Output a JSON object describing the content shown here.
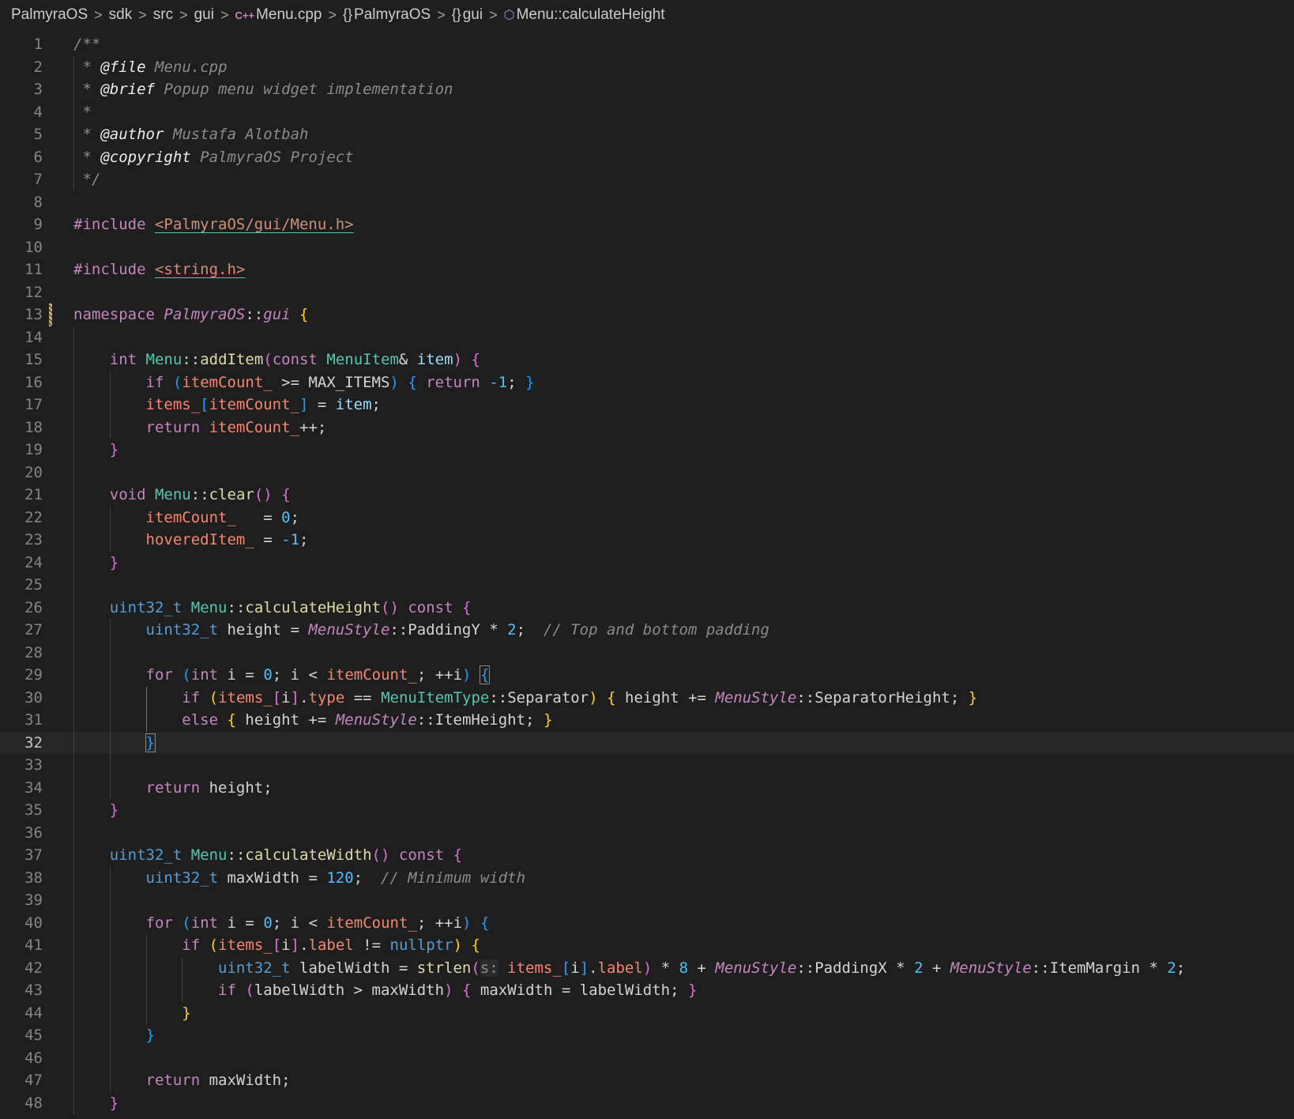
{
  "breadcrumb": {
    "items": [
      {
        "label": "PalmyraOS",
        "icon": ""
      },
      {
        "label": "sdk",
        "icon": ""
      },
      {
        "label": "src",
        "icon": ""
      },
      {
        "label": "gui",
        "icon": ""
      },
      {
        "label": "Menu.cpp",
        "icon": "cpp-file-icon"
      },
      {
        "label": "PalmyraOS",
        "icon": "namespace-braces-icon"
      },
      {
        "label": "gui",
        "icon": "namespace-braces-icon"
      },
      {
        "label": "Menu::calculateHeight",
        "icon": "method-cube-icon"
      }
    ],
    "separator": ">"
  },
  "editor": {
    "current_line": 32,
    "lines": [
      {
        "n": "1",
        "code": "/**"
      },
      {
        "n": "2",
        "code": " * @file Menu.cpp"
      },
      {
        "n": "3",
        "code": " * @brief Popup menu widget implementation"
      },
      {
        "n": "4",
        "code": " *"
      },
      {
        "n": "5",
        "code": " * @author Mustafa Alotbah"
      },
      {
        "n": "6",
        "code": " * @copyright PalmyraOS Project"
      },
      {
        "n": "7",
        "code": " */"
      },
      {
        "n": "8",
        "code": ""
      },
      {
        "n": "9",
        "code": "#include <PalmyraOS/gui/Menu.h>"
      },
      {
        "n": "10",
        "code": ""
      },
      {
        "n": "11",
        "code": "#include <string.h>"
      },
      {
        "n": "12",
        "code": ""
      },
      {
        "n": "13",
        "code": "namespace PalmyraOS::gui {"
      },
      {
        "n": "14",
        "code": ""
      },
      {
        "n": "15",
        "code": "    int Menu::addItem(const MenuItem& item) {"
      },
      {
        "n": "16",
        "code": "        if (itemCount_ >= MAX_ITEMS) { return -1; }"
      },
      {
        "n": "17",
        "code": "        items_[itemCount_] = item;"
      },
      {
        "n": "18",
        "code": "        return itemCount_++;"
      },
      {
        "n": "19",
        "code": "    }"
      },
      {
        "n": "20",
        "code": ""
      },
      {
        "n": "21",
        "code": "    void Menu::clear() {"
      },
      {
        "n": "22",
        "code": "        itemCount_   = 0;"
      },
      {
        "n": "23",
        "code": "        hoveredItem_ = -1;"
      },
      {
        "n": "24",
        "code": "    }"
      },
      {
        "n": "25",
        "code": ""
      },
      {
        "n": "26",
        "code": "    uint32_t Menu::calculateHeight() const {"
      },
      {
        "n": "27",
        "code": "        uint32_t height = MenuStyle::PaddingY * 2;  // Top and bottom padding"
      },
      {
        "n": "28",
        "code": ""
      },
      {
        "n": "29",
        "code": "        for (int i = 0; i < itemCount_; ++i) {"
      },
      {
        "n": "30",
        "code": "            if (items_[i].type == MenuItemType::Separator) { height += MenuStyle::SeparatorHeight; }"
      },
      {
        "n": "31",
        "code": "            else { height += MenuStyle::ItemHeight; }"
      },
      {
        "n": "32",
        "code": "        }"
      },
      {
        "n": "33",
        "code": ""
      },
      {
        "n": "34",
        "code": "        return height;"
      },
      {
        "n": "35",
        "code": "    }"
      },
      {
        "n": "36",
        "code": ""
      },
      {
        "n": "37",
        "code": "    uint32_t Menu::calculateWidth() const {"
      },
      {
        "n": "38",
        "code": "        uint32_t maxWidth = 120;  // Minimum width"
      },
      {
        "n": "39",
        "code": ""
      },
      {
        "n": "40",
        "code": "        for (int i = 0; i < itemCount_; ++i) {"
      },
      {
        "n": "41",
        "code": "            if (items_[i].label != nullptr) {"
      },
      {
        "n": "42",
        "code": "                uint32_t labelWidth = strlen(s: items_[i].label) * 8 + MenuStyle::PaddingX * 2 + MenuStyle::ItemMargin * 2;"
      },
      {
        "n": "43",
        "code": "                if (labelWidth > maxWidth) { maxWidth = labelWidth; }"
      },
      {
        "n": "44",
        "code": "            }"
      },
      {
        "n": "45",
        "code": "        }"
      },
      {
        "n": "46",
        "code": ""
      },
      {
        "n": "47",
        "code": "        return maxWidth;"
      },
      {
        "n": "48",
        "code": "    }"
      }
    ]
  }
}
